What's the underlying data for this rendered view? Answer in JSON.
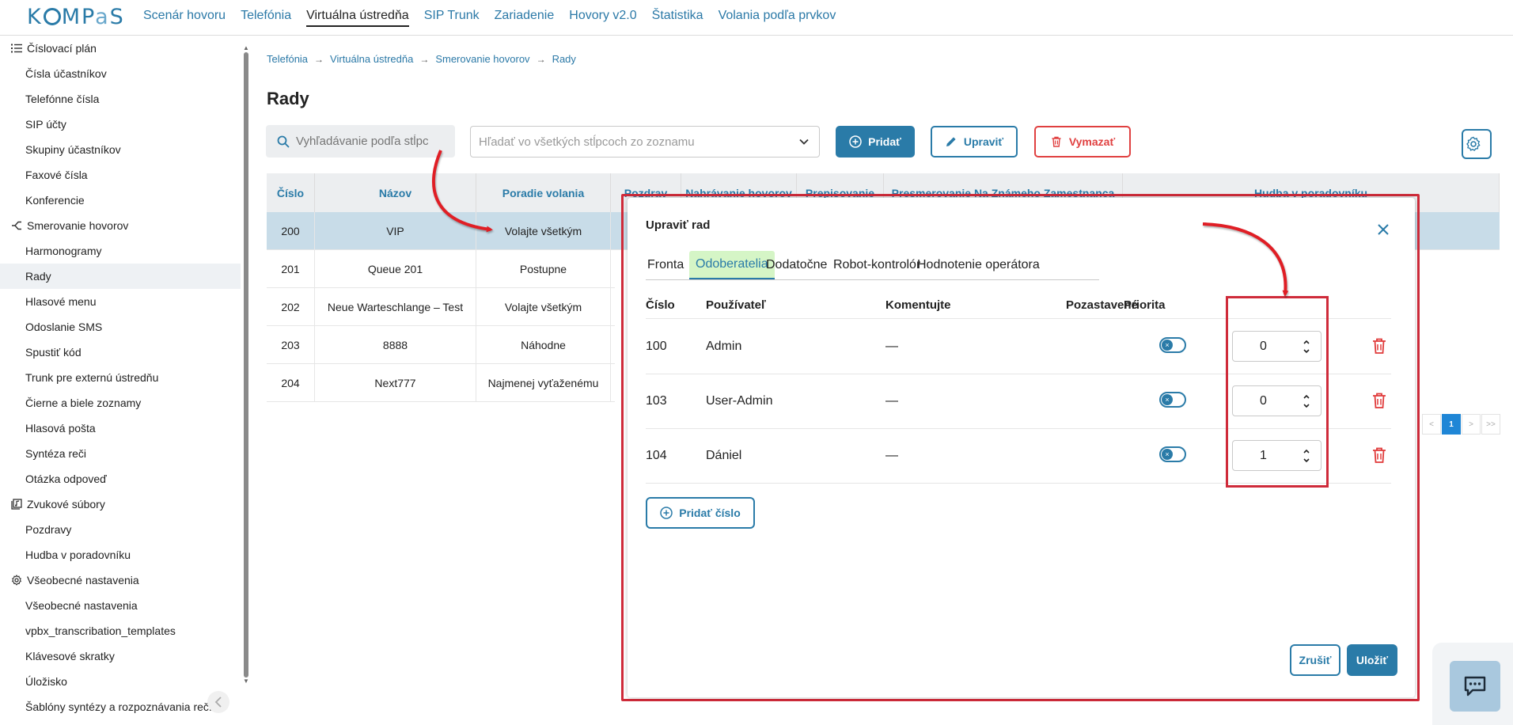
{
  "brand": {
    "logo_text_a": "K",
    "logo_text_b": "MP",
    "logo_text_c": "a",
    "logo_text_d": "S"
  },
  "nav": {
    "items": [
      "Scenár hovoru",
      "Telefónia",
      "Virtuálna ústredňa",
      "SIP Trunk",
      "Zariadenie",
      "Hovory v2.0",
      "Štatistika",
      "Volania podľa prvkov"
    ],
    "active_index": 2
  },
  "sidebar": {
    "items": [
      {
        "label": "Číslovací plán",
        "type": "group",
        "icon": "list-icon"
      },
      {
        "label": "Čísla účastníkov",
        "type": "sub"
      },
      {
        "label": "Telefónne čísla",
        "type": "sub"
      },
      {
        "label": "SIP účty",
        "type": "sub"
      },
      {
        "label": "Skupiny účastníkov",
        "type": "sub"
      },
      {
        "label": "Faxové čísla",
        "type": "sub"
      },
      {
        "label": "Konferencie",
        "type": "sub"
      },
      {
        "label": "Smerovanie hovorov",
        "type": "group",
        "icon": "route-icon"
      },
      {
        "label": "Harmonogramy",
        "type": "sub"
      },
      {
        "label": "Rady",
        "type": "sub",
        "selected": true
      },
      {
        "label": "Hlasové menu",
        "type": "sub"
      },
      {
        "label": "Odoslanie SMS",
        "type": "sub"
      },
      {
        "label": "Spustiť kód",
        "type": "sub"
      },
      {
        "label": "Trunk pre externú ústredňu",
        "type": "sub"
      },
      {
        "label": "Čierne a biele zoznamy",
        "type": "sub"
      },
      {
        "label": "Hlasová pošta",
        "type": "sub"
      },
      {
        "label": "Syntéza reči",
        "type": "sub"
      },
      {
        "label": "Otázka odpoveď",
        "type": "sub"
      },
      {
        "label": "Zvukové súbory",
        "type": "group",
        "icon": "audio-library-icon"
      },
      {
        "label": "Pozdravy",
        "type": "sub"
      },
      {
        "label": "Hudba v poradovníku",
        "type": "sub"
      },
      {
        "label": "Všeobecné nastavenia",
        "type": "group",
        "icon": "gear-icon"
      },
      {
        "label": "Všeobecné nastavenia",
        "type": "sub"
      },
      {
        "label": "vpbx_transcribation_templates",
        "type": "sub"
      },
      {
        "label": "Klávesové skratky",
        "type": "sub"
      },
      {
        "label": "Úložisko",
        "type": "sub"
      },
      {
        "label": "Šablóny syntézy a rozpoznávania reč...",
        "type": "sub"
      }
    ]
  },
  "breadcrumb": [
    "Telefónia",
    "Virtuálna ústredňa",
    "Smerovanie hovorov",
    "Rady"
  ],
  "page": {
    "title": "Rady"
  },
  "toolbar": {
    "search_placeholder": "Vyhľadávanie podľa stĺpc",
    "filter_placeholder": "Hľadať vo všetkých stĺpcoch zo zoznamu",
    "add_label": "Pridať",
    "edit_label": "Upraviť",
    "delete_label": "Vymazať"
  },
  "table": {
    "columns": [
      "Číslo",
      "Názov",
      "Poradie volania",
      "Pozdrav",
      "Nahrávanie hovorov",
      "Prepisovanie",
      "Presmerovanie Na Známeho Zamestnanca",
      "Hudba v poradovníku"
    ],
    "rows": [
      {
        "cislo": "200",
        "nazov": "VIP",
        "poradie": "Volajte všetkým"
      },
      {
        "cislo": "201",
        "nazov": "Queue 201",
        "poradie": "Postupne"
      },
      {
        "cislo": "202",
        "nazov": "Neue Warteschlange – Test",
        "poradie": "Volajte všetkým"
      },
      {
        "cislo": "203",
        "nazov": "8888",
        "poradie": "Náhodne"
      },
      {
        "cislo": "204",
        "nazov": "Next777",
        "poradie": "Najmenej vyťaženému"
      }
    ],
    "selected_index": 0
  },
  "pager": {
    "prev": "<",
    "current": "1",
    "next": ">",
    "last": ">>"
  },
  "modal": {
    "title": "Upraviť rad",
    "tabs": [
      "Fronta",
      "Odoberatelia",
      "Dodatočne",
      "Robot-kontrolór",
      "Hodnotenie operátora"
    ],
    "active_tab": 1,
    "columns": [
      "Číslo",
      "Používateľ",
      "Komentujte",
      "Pozastavené",
      "Priorita"
    ],
    "rows": [
      {
        "cislo": "100",
        "user": "Admin",
        "comment": "—",
        "paused": false,
        "priority": "0"
      },
      {
        "cislo": "103",
        "user": "User-Admin",
        "comment": "—",
        "paused": false,
        "priority": "0"
      },
      {
        "cislo": "104",
        "user": "Dániel",
        "comment": "—",
        "paused": false,
        "priority": "1"
      }
    ],
    "add_number_label": "Pridať číslo",
    "cancel_label": "Zrušiť",
    "save_label": "Uložiť"
  },
  "colors": {
    "accent": "#2a7ba8",
    "danger": "#e04040",
    "highlight": "#cf2b3a",
    "tab_active_bg": "#d5f5c6"
  }
}
